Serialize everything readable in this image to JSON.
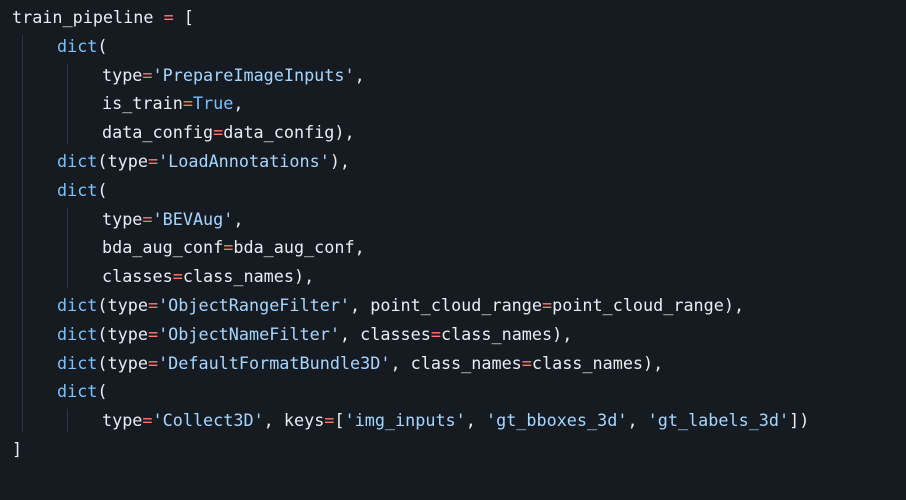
{
  "colors": {
    "background": "#161b22",
    "text": "#e6edf3",
    "builtin": "#79c0ff",
    "string": "#a5d6ff",
    "operator": "#ff7b72",
    "constant": "#79c0ff"
  },
  "code": {
    "lines": [
      {
        "indent": 0,
        "tokens": [
          [
            "plain",
            "train_pipeline "
          ],
          [
            "op",
            "="
          ],
          [
            "plain",
            " ["
          ]
        ]
      },
      {
        "indent": 1,
        "tokens": [
          [
            "builtin",
            "dict"
          ],
          [
            "plain",
            "("
          ]
        ]
      },
      {
        "indent": 2,
        "tokens": [
          [
            "plain",
            "type"
          ],
          [
            "op",
            "="
          ],
          [
            "string",
            "'PrepareImageInputs'"
          ],
          [
            "plain",
            ","
          ]
        ]
      },
      {
        "indent": 2,
        "tokens": [
          [
            "plain",
            "is_train"
          ],
          [
            "op",
            "="
          ],
          [
            "const",
            "True"
          ],
          [
            "plain",
            ","
          ]
        ]
      },
      {
        "indent": 2,
        "tokens": [
          [
            "plain",
            "data_config"
          ],
          [
            "op",
            "="
          ],
          [
            "plain",
            "data_config),"
          ]
        ]
      },
      {
        "indent": 1,
        "tokens": [
          [
            "builtin",
            "dict"
          ],
          [
            "plain",
            "(type"
          ],
          [
            "op",
            "="
          ],
          [
            "string",
            "'LoadAnnotations'"
          ],
          [
            "plain",
            "),"
          ]
        ]
      },
      {
        "indent": 1,
        "tokens": [
          [
            "builtin",
            "dict"
          ],
          [
            "plain",
            "("
          ]
        ]
      },
      {
        "indent": 2,
        "tokens": [
          [
            "plain",
            "type"
          ],
          [
            "op",
            "="
          ],
          [
            "string",
            "'BEVAug'"
          ],
          [
            "plain",
            ","
          ]
        ]
      },
      {
        "indent": 2,
        "tokens": [
          [
            "plain",
            "bda_aug_conf"
          ],
          [
            "op",
            "="
          ],
          [
            "plain",
            "bda_aug_conf,"
          ]
        ]
      },
      {
        "indent": 2,
        "tokens": [
          [
            "plain",
            "classes"
          ],
          [
            "op",
            "="
          ],
          [
            "plain",
            "class_names),"
          ]
        ]
      },
      {
        "indent": 1,
        "tokens": [
          [
            "builtin",
            "dict"
          ],
          [
            "plain",
            "(type"
          ],
          [
            "op",
            "="
          ],
          [
            "string",
            "'ObjectRangeFilter'"
          ],
          [
            "plain",
            ", point_cloud_range"
          ],
          [
            "op",
            "="
          ],
          [
            "plain",
            "point_cloud_range),"
          ]
        ]
      },
      {
        "indent": 1,
        "tokens": [
          [
            "builtin",
            "dict"
          ],
          [
            "plain",
            "(type"
          ],
          [
            "op",
            "="
          ],
          [
            "string",
            "'ObjectNameFilter'"
          ],
          [
            "plain",
            ", classes"
          ],
          [
            "op",
            "="
          ],
          [
            "plain",
            "class_names),"
          ]
        ]
      },
      {
        "indent": 1,
        "tokens": [
          [
            "builtin",
            "dict"
          ],
          [
            "plain",
            "(type"
          ],
          [
            "op",
            "="
          ],
          [
            "string",
            "'DefaultFormatBundle3D'"
          ],
          [
            "plain",
            ", class_names"
          ],
          [
            "op",
            "="
          ],
          [
            "plain",
            "class_names),"
          ]
        ]
      },
      {
        "indent": 1,
        "tokens": [
          [
            "builtin",
            "dict"
          ],
          [
            "plain",
            "("
          ]
        ]
      },
      {
        "indent": 2,
        "tokens": [
          [
            "plain",
            "type"
          ],
          [
            "op",
            "="
          ],
          [
            "string",
            "'Collect3D'"
          ],
          [
            "plain",
            ", keys"
          ],
          [
            "op",
            "="
          ],
          [
            "plain",
            "["
          ],
          [
            "string",
            "'img_inputs'"
          ],
          [
            "plain",
            ", "
          ],
          [
            "string",
            "'gt_bboxes_3d'"
          ],
          [
            "plain",
            ", "
          ],
          [
            "string",
            "'gt_labels_3d'"
          ],
          [
            "plain",
            "])"
          ]
        ]
      },
      {
        "indent": 0,
        "tokens": [
          [
            "plain",
            "]"
          ]
        ]
      }
    ]
  }
}
